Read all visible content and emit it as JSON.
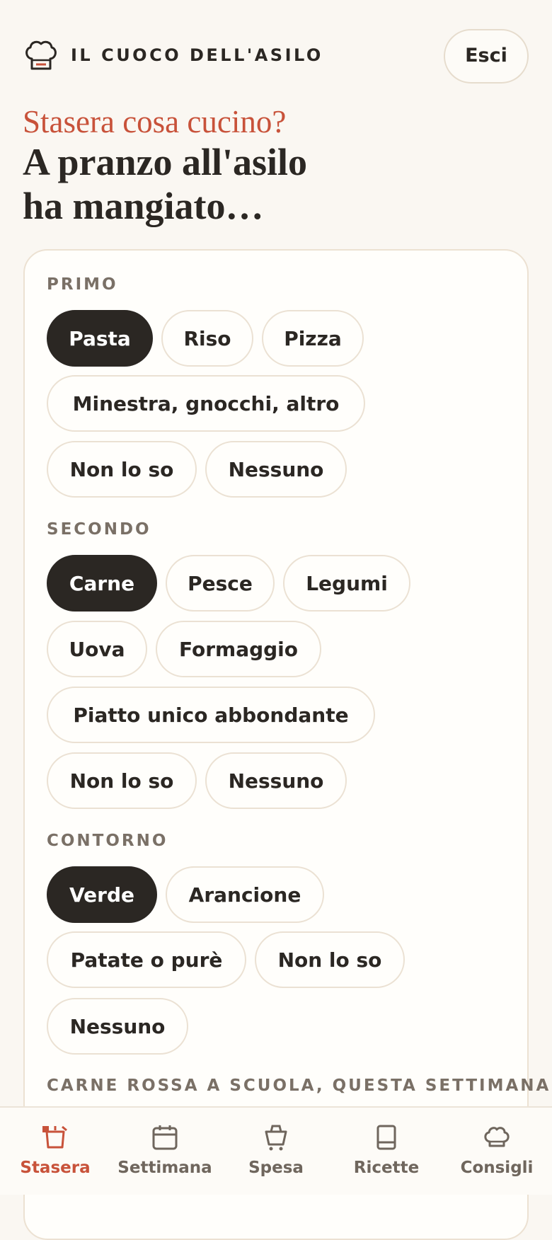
{
  "app": {
    "brand": "IL CUOCO DELL'ASILO",
    "logout_label": "Esci"
  },
  "hero": {
    "subtitle": "Stasera cosa cucino?",
    "title_line1": "A pranzo all'asilo",
    "title_line2": "ha mangiato…"
  },
  "sections": {
    "primo": {
      "label": "PRIMO",
      "options": [
        "Pasta",
        "Riso",
        "Pizza",
        "Minestra, gnocchi, altro",
        "Non lo so",
        "Nessuno"
      ],
      "selected": "Pasta"
    },
    "secondo": {
      "label": "SECONDO",
      "options": [
        "Carne",
        "Pesce",
        "Legumi",
        "Uova",
        "Formaggio",
        "Piatto unico abbondante",
        "Non lo so",
        "Nessuno"
      ],
      "selected": "Carne"
    },
    "contorno": {
      "label": "CONTORNO",
      "options": [
        "Verde",
        "Arancione",
        "Patate o purè",
        "Non lo so",
        "Nessuno"
      ],
      "selected": "Verde"
    },
    "carne_rossa": {
      "label": "CARNE ROSSA A SCUOLA, QUESTA SETTIMANA"
    }
  },
  "tabs": [
    {
      "label": "Stasera",
      "icon": "pot-icon",
      "active": true
    },
    {
      "label": "Settimana",
      "icon": "calendar-icon",
      "active": false
    },
    {
      "label": "Spesa",
      "icon": "basket-icon",
      "active": false
    },
    {
      "label": "Ricette",
      "icon": "book-icon",
      "active": false
    },
    {
      "label": "Consigli",
      "icon": "chef-hat-icon",
      "active": false
    }
  ],
  "colors": {
    "accent": "#c8523a",
    "selected_chip": "#2b2723",
    "background": "#faf7f2",
    "border": "#ece1d2"
  }
}
